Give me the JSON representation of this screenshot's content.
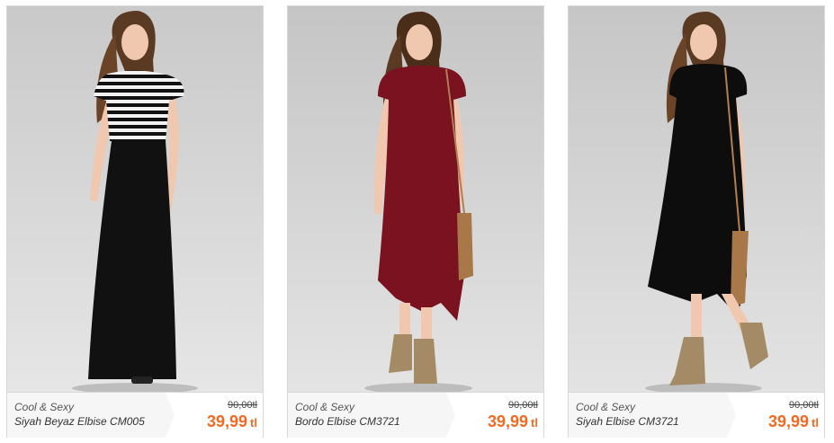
{
  "products": [
    {
      "brand": "Cool & Sexy",
      "name": "Siyah Beyaz Elbise CM005",
      "old_price": "90,00tl",
      "price": "39,99",
      "currency": "tl",
      "image_description": "model wearing black and white striped maxi dress",
      "colors": {
        "bg_top": "#c9c9c9",
        "bg_bottom": "#e6e6e6",
        "dress": "#111111",
        "top": "#f2f2f2"
      }
    },
    {
      "brand": "Cool & Sexy",
      "name": "Bordo Elbise CM3721",
      "old_price": "90,00tl",
      "price": "39,99",
      "currency": "tl",
      "image_description": "model wearing burgundy asymmetric dress with fringe bag and boots",
      "colors": {
        "bg_top": "#c5c5c5",
        "bg_bottom": "#e4e4e4",
        "dress": "#7a1220",
        "top": "#7a1220"
      }
    },
    {
      "brand": "Cool & Sexy",
      "name": "Siyah Elbise CM3721",
      "old_price": "90,00tl",
      "price": "39,99",
      "currency": "tl",
      "image_description": "model wearing black asymmetric dress with fringe bag and boots",
      "colors": {
        "bg_top": "#c6c6c6",
        "bg_bottom": "#e3e3e3",
        "dress": "#0d0d0d",
        "top": "#0d0d0d"
      }
    }
  ]
}
